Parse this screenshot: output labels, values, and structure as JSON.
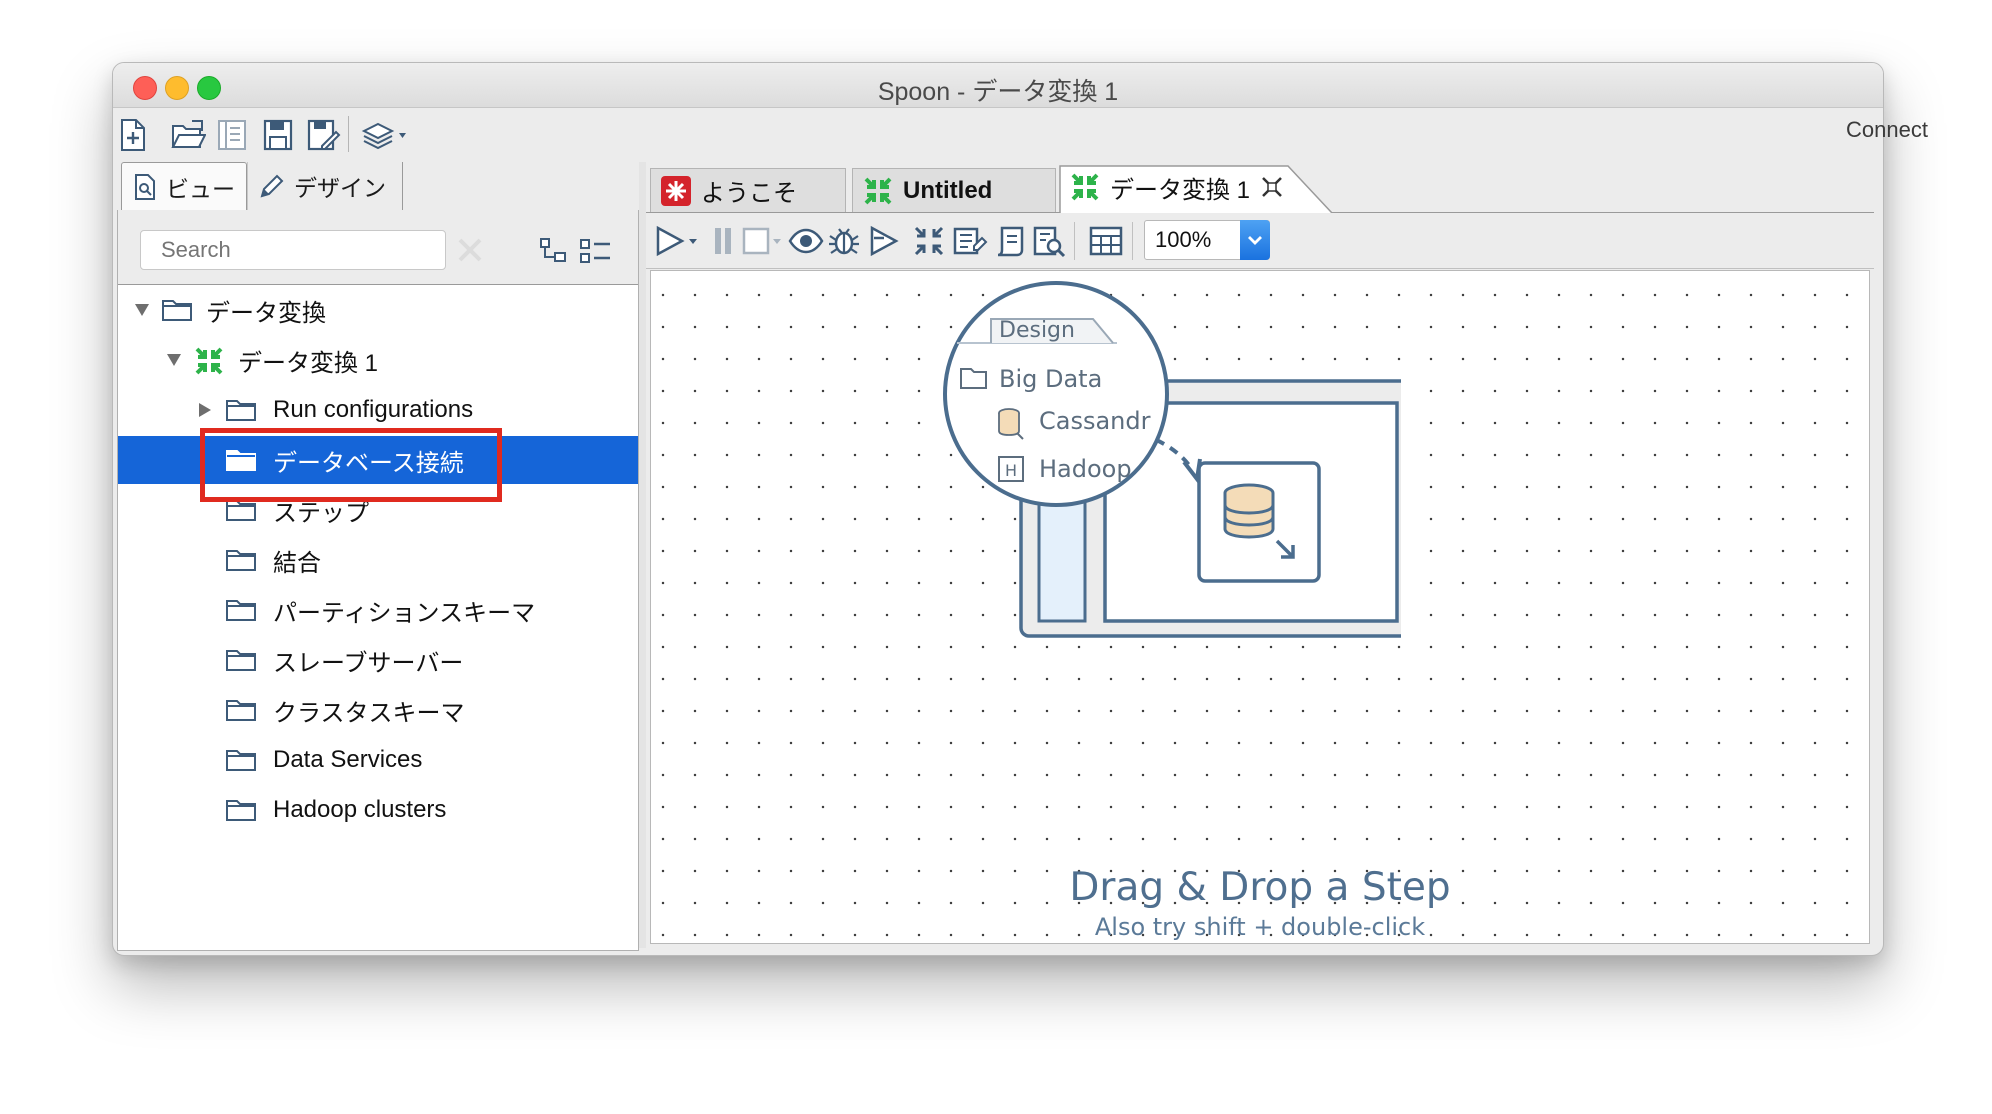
{
  "window": {
    "title": "Spoon - データ変換 1",
    "traffic_lights": {
      "close": "#fe5f57",
      "minimize": "#febc2e",
      "zoom": "#28c840"
    }
  },
  "main_toolbar": {
    "icons": [
      "new-file-icon",
      "open-file-icon",
      "explore-repository-icon",
      "save-icon",
      "save-as-icon",
      "perspective-layers-icon"
    ],
    "connect_label": "Connect"
  },
  "left_panel": {
    "tabs": [
      {
        "label": "ビュー",
        "icon": "view-tab-icon",
        "active": true
      },
      {
        "label": "デザイン",
        "icon": "pencil-icon",
        "active": false
      }
    ],
    "search": {
      "placeholder": "Search"
    },
    "tree": [
      {
        "label": "データ変換",
        "icon": "folder-icon",
        "expanded": true
      },
      {
        "label": "データ変換 1",
        "icon": "transformation-icon",
        "expanded": true
      },
      {
        "label": "Run configurations",
        "icon": "folder-icon",
        "expanded": false
      },
      {
        "label": "データベース接続",
        "icon": "folder-icon",
        "selected": true
      },
      {
        "label": "ステップ",
        "icon": "folder-icon"
      },
      {
        "label": "結合",
        "icon": "folder-icon"
      },
      {
        "label": "パーティションスキーマ",
        "icon": "folder-icon"
      },
      {
        "label": "スレーブサーバー",
        "icon": "folder-icon"
      },
      {
        "label": "クラスタスキーマ",
        "icon": "folder-icon"
      },
      {
        "label": "Data Services",
        "icon": "folder-icon"
      },
      {
        "label": "Hadoop clusters",
        "icon": "folder-icon"
      }
    ],
    "highlight_color": "#e02a1f",
    "selection_color": "#1565d8"
  },
  "editor": {
    "tabs": [
      {
        "label": "ようこそ",
        "icon": "welcome-icon",
        "active": false
      },
      {
        "label": "Untitled",
        "icon": "transformation-icon",
        "active": false
      },
      {
        "label": "データ変換 1",
        "icon": "transformation-icon",
        "active": true,
        "closable": true
      }
    ],
    "toolbar": {
      "icons": [
        "run-icon",
        "pause-icon",
        "stop-icon",
        "preview-icon",
        "debug-icon",
        "replay-icon",
        "verify-icon",
        "impact-icon",
        "sql-icon",
        "explore-db-icon",
        "show-results-icon"
      ],
      "zoom": "100%"
    },
    "canvas": {
      "illustration": {
        "tab_label": "Design",
        "items": [
          "Big Data",
          "Cassandr",
          "Hadoop"
        ]
      },
      "headline": "Drag & Drop a Step",
      "hint": "Also try shift + double-click"
    }
  }
}
